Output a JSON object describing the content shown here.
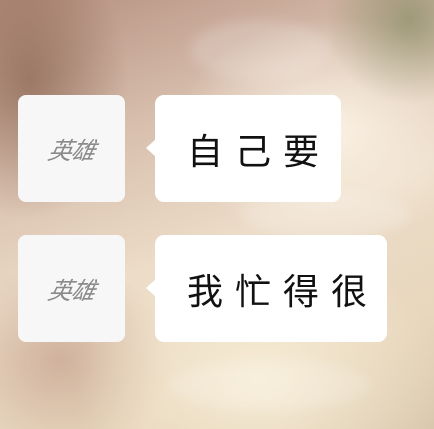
{
  "messages": [
    {
      "avatar_label": "英雄",
      "text": "自己要"
    },
    {
      "avatar_label": "英雄",
      "text": "我忙得很"
    }
  ]
}
